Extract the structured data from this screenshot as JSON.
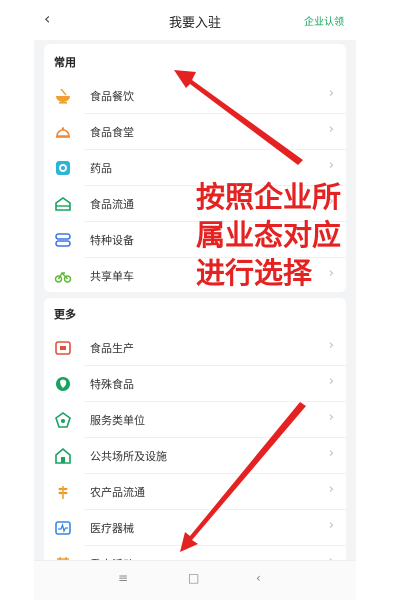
{
  "header": {
    "back_icon": "back-chevron-icon",
    "title": "我要入驻",
    "right_link": "企业认领"
  },
  "sections": [
    {
      "title": "常用",
      "items": [
        {
          "label": "食品餐饮",
          "icon": "bowl-icon",
          "color": "#f0a030"
        },
        {
          "label": "食品食堂",
          "icon": "dish-cover-icon",
          "color": "#f08a3a"
        },
        {
          "label": "药品",
          "icon": "medicine-icon",
          "color": "#2cb5d6"
        },
        {
          "label": "食品流通",
          "icon": "stall-icon",
          "color": "#1aa260"
        },
        {
          "label": "特种设备",
          "icon": "equipment-icon",
          "color": "#3a76e0"
        },
        {
          "label": "共享单车",
          "icon": "bike-icon",
          "color": "#5cb82e"
        }
      ]
    },
    {
      "title": "更多",
      "items": [
        {
          "label": "食品生产",
          "icon": "production-icon",
          "color": "#e0503a"
        },
        {
          "label": "特殊食品",
          "icon": "special-food-icon",
          "color": "#1aa260"
        },
        {
          "label": "服务类单位",
          "icon": "service-icon",
          "color": "#1aa260"
        },
        {
          "label": "公共场所及设施",
          "icon": "public-place-icon",
          "color": "#1aa260"
        },
        {
          "label": "农产品流通",
          "icon": "wheat-icon",
          "color": "#e89a2a"
        },
        {
          "label": "医疗器械",
          "icon": "medical-device-icon",
          "color": "#3a86e0"
        },
        {
          "label": "重大活动",
          "icon": "event-icon",
          "color": "#e8a02a"
        }
      ]
    }
  ],
  "annotation": {
    "text": "按照企业所属业态对应进行选择",
    "color": "#e52222"
  },
  "navbar": {
    "menu_icon": "menu-lines-icon",
    "home_icon": "home-square-icon",
    "back_icon": "back-triangle-icon"
  }
}
